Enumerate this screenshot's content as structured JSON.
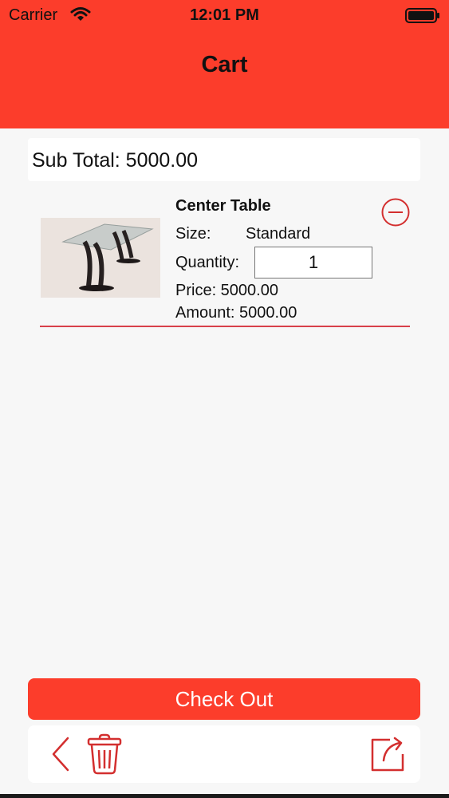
{
  "status_bar": {
    "carrier": "Carrier",
    "time": "12:01 PM"
  },
  "header": {
    "title": "Cart"
  },
  "summary": {
    "subtotal_text": "Sub Total: 5000.00"
  },
  "cart_items": [
    {
      "name": "Center Table",
      "size_label": "Size:",
      "size_value": "Standard",
      "quantity_label": "Quantity:",
      "quantity": "1",
      "price_text": "Price: 5000.00",
      "amount_text": "Amount: 5000.00"
    }
  ],
  "actions": {
    "checkout_label": "Check Out"
  },
  "toolbar": {
    "back_icon": "chevron-left-icon",
    "trash_icon": "trash-icon",
    "share_icon": "share-icon"
  },
  "colors": {
    "accent": "#fc3d2b",
    "divider": "#d8404a",
    "icon": "#d32f2f",
    "background": "#f7f7f7"
  }
}
